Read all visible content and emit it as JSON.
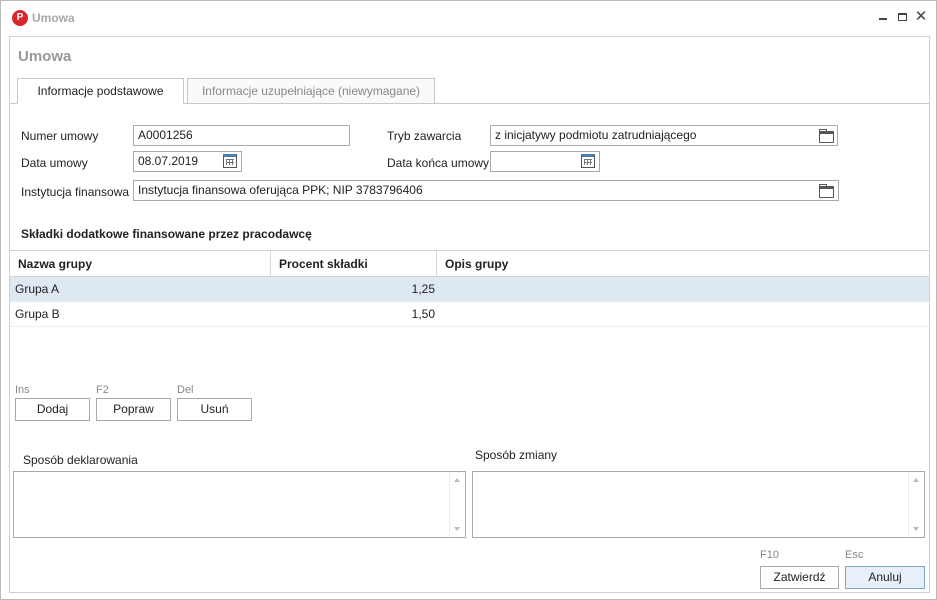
{
  "window": {
    "title": "Umowa",
    "app_icon": "P"
  },
  "form": {
    "title": "Umowa"
  },
  "tabs": [
    {
      "label": "Informacje podstawowe",
      "active": true
    },
    {
      "label": "Informacje uzupełniające (niewymagane)",
      "active": false
    }
  ],
  "fields": {
    "numer_umowy": {
      "label": "Numer umowy",
      "value": "A0001256"
    },
    "data_umowy": {
      "label": "Data umowy",
      "value": "08.07.2019"
    },
    "instytucja": {
      "label": "Instytucja finansowa",
      "value": "Instytucja finansowa oferująca PPK; NIP 3783796406"
    },
    "tryb": {
      "label": "Tryb zawarcia",
      "value": "z inicjatywy podmiotu zatrudniającego"
    },
    "data_konca": {
      "label": "Data końca umowy",
      "value": ""
    }
  },
  "section": {
    "title": "Składki dodatkowe finansowane przez pracodawcę"
  },
  "grid": {
    "columns": [
      "Nazwa grupy",
      "Procent składki",
      "Opis grupy"
    ],
    "rows": [
      {
        "name": "Grupa A",
        "percent": "1,25",
        "desc": "",
        "selected": true
      },
      {
        "name": "Grupa B",
        "percent": "1,50",
        "desc": "",
        "selected": false
      }
    ]
  },
  "grid_buttons": {
    "add": {
      "shortcut": "Ins",
      "label": "Dodaj"
    },
    "edit": {
      "shortcut": "F2",
      "label": "Popraw"
    },
    "delete": {
      "shortcut": "Del",
      "label": "Usuń"
    }
  },
  "memos": {
    "declaration": {
      "label": "Sposób deklarowania",
      "value": ""
    },
    "change": {
      "label": "Sposób zmiany",
      "value": ""
    }
  },
  "footer": {
    "confirm": {
      "shortcut": "F10",
      "label": "Zatwierdź"
    },
    "cancel": {
      "shortcut": "Esc",
      "label": "Anuluj"
    }
  },
  "colors": {
    "accent": "#d9262e",
    "selection": "#dde8f3",
    "primary_button": "#e7f0f9"
  }
}
